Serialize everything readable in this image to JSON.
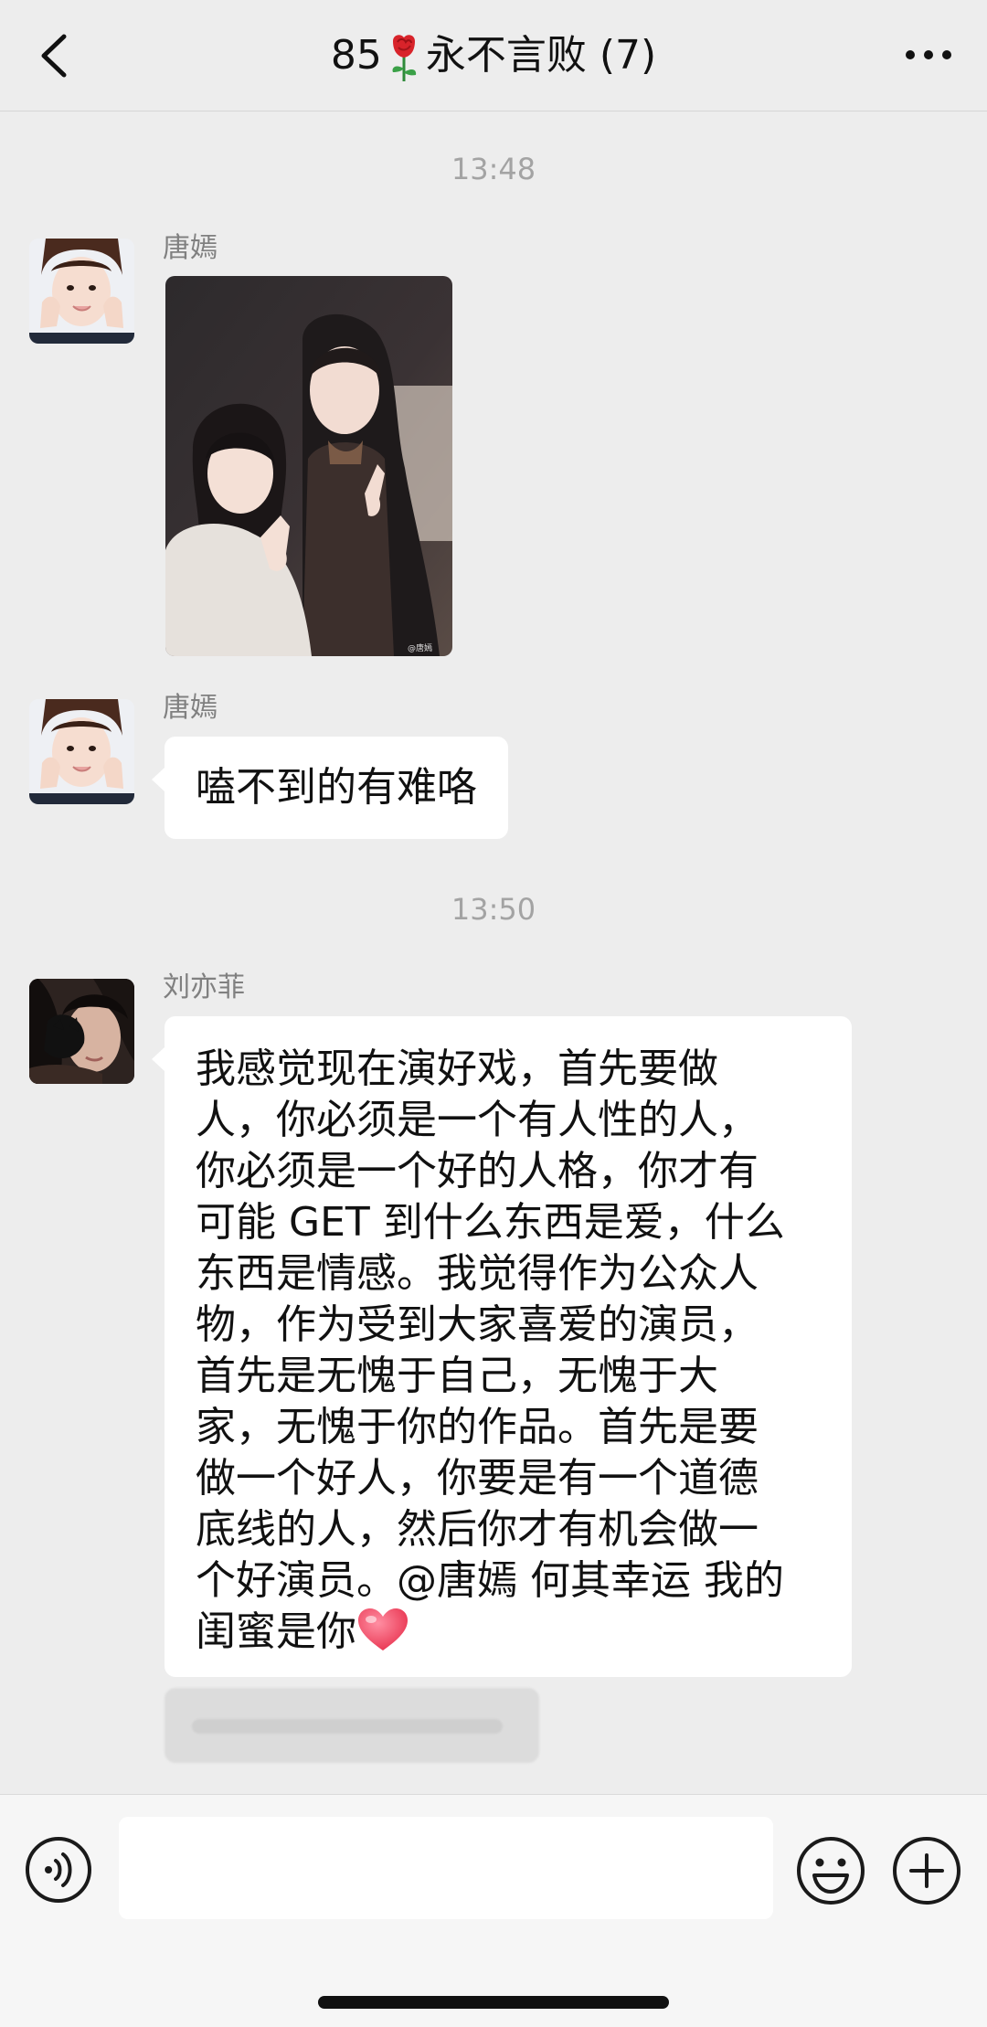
{
  "header": {
    "title_prefix": "85",
    "title_emoji": "rose-icon",
    "title_name": "永不言败",
    "member_count": "(7)",
    "back_icon": "chevron-left-icon",
    "more_icon": "more-dots-icon"
  },
  "messages": [
    {
      "type": "timestamp",
      "text": "13:48"
    },
    {
      "type": "image",
      "sender": "唐嫣",
      "avatar": "avatar-tangyan",
      "watermark": "@唐嫣"
    },
    {
      "type": "text",
      "sender": "唐嫣",
      "avatar": "avatar-tangyan",
      "text": "嗑不到的有难咯"
    },
    {
      "type": "timestamp",
      "text": "13:50"
    },
    {
      "type": "text",
      "sender": "刘亦菲",
      "avatar": "avatar-liuyifei",
      "lines": [
        "我感觉现在演好戏，首先要做",
        "人，你必须是一个有人性的人，",
        "你必须是一个好的人格，你才有",
        "可能 GET 到什么东西是爱，什么",
        "东西是情感。我觉得作为公众人",
        "物，作为受到大家喜爱的演员，",
        "首先是无愧于自己，无愧于大",
        "家，无愧于你的作品。首先是要",
        "做一个好人，你要是有一个道德",
        "底线的人，然后你才有机会做一",
        "个好演员。@唐嫣 何其幸运 我的",
        "闺蜜是你"
      ],
      "trailing_emoji": "heart-icon"
    },
    {
      "type": "blurred",
      "sender": "",
      "text": ""
    }
  ],
  "input_bar": {
    "voice_icon": "voice-icon",
    "input_value": "",
    "emoji_icon": "emoji-icon",
    "plus_icon": "plus-icon"
  },
  "colors": {
    "background": "#ededed",
    "bubble": "#ffffff",
    "heart": "#f0506e",
    "rose": "#d8232a"
  }
}
